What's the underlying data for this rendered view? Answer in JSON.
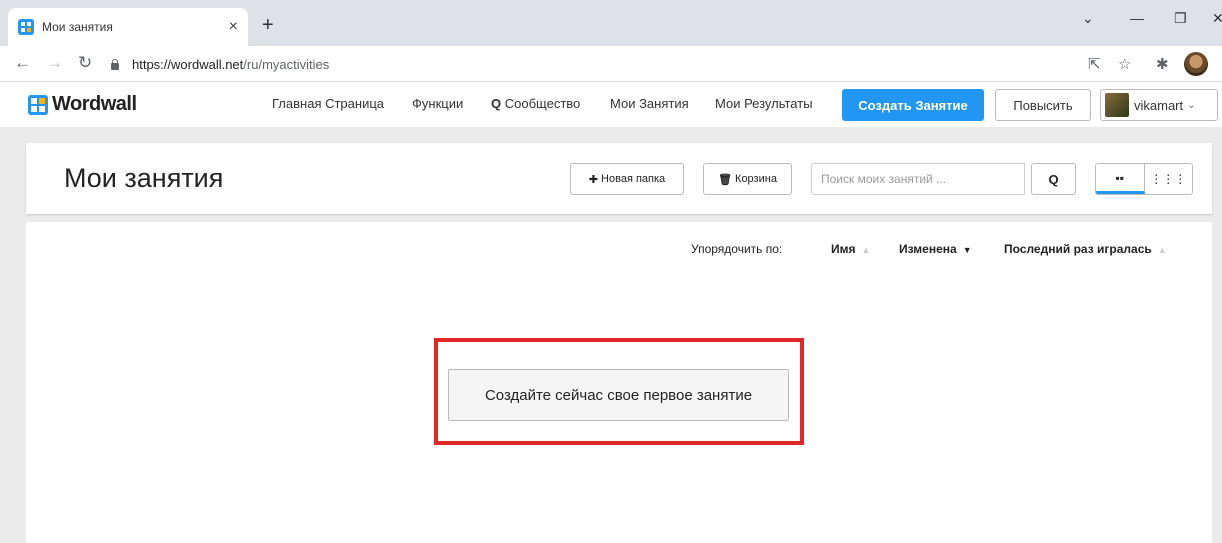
{
  "browser": {
    "tab_title": "Мои занятия",
    "url_host": "https://wordwall.net",
    "url_path": "/ru/myactivities"
  },
  "site": {
    "logo": "Wordwall",
    "nav": [
      {
        "label": "Главная Страница"
      },
      {
        "label": "Функции"
      },
      {
        "label": "Сообщество"
      },
      {
        "label": "Мои Занятия"
      },
      {
        "label": "Мои Результаты"
      }
    ],
    "create_label": "Создать Занятие",
    "upgrade_label": "Повысить",
    "username": "vikamart"
  },
  "page": {
    "title": "Мои занятия",
    "new_folder_label": "Новая папка",
    "trash_label": "Корзина",
    "search_placeholder": "Поиск моих занятий ...",
    "sort_label": "Упорядочить по:",
    "sort_name": "Имя",
    "sort_modified": "Изменена",
    "sort_last_played": "Последний раз игралась",
    "empty_cta": "Создайте сейчас свое первое занятие"
  },
  "colors": {
    "accent": "#2196f3",
    "highlight": "#e02828"
  }
}
